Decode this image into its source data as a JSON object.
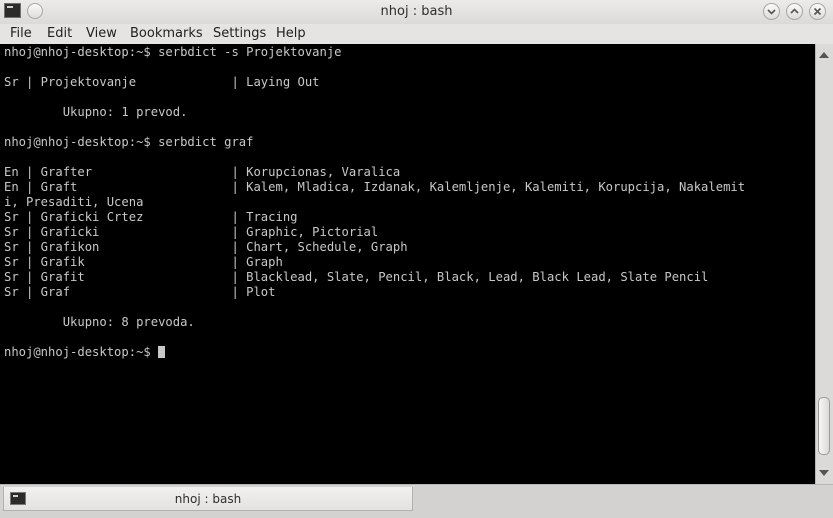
{
  "window": {
    "title": "nhoj : bash"
  },
  "menu": {
    "items": [
      "File",
      "Edit",
      "View",
      "Bookmarks",
      "Settings",
      "Help"
    ]
  },
  "terminal": {
    "lines": [
      "nhoj@nhoj-desktop:~$ serbdict -s Projektovanje",
      "",
      "Sr | Projektovanje             | Laying Out",
      "",
      "        Ukupno: 1 prevod.",
      "",
      "nhoj@nhoj-desktop:~$ serbdict graf",
      "",
      "En | Grafter                   | Korupcionas, Varalica",
      "En | Graft                     | Kalem, Mladica, Izdanak, Kalemljenje, Kalemiti, Korupcija, Nakalemit",
      "i, Presaditi, Ucena",
      "Sr | Graficki Crtez            | Tracing",
      "Sr | Graficki                  | Graphic, Pictorial",
      "Sr | Grafikon                  | Chart, Schedule, Graph",
      "Sr | Grafik                    | Graph",
      "Sr | Grafit                    | Blacklead, Slate, Pencil, Black, Lead, Black Lead, Slate Pencil",
      "Sr | Graf                      | Plot",
      "",
      "        Ukupno: 8 prevoda.",
      "",
      "nhoj@nhoj-desktop:~$ "
    ]
  },
  "tabs": [
    {
      "label": "nhoj : bash"
    }
  ],
  "icons": {
    "app": "terminal-icon",
    "pin": "pin-icon",
    "minimize": "chevron-down-icon",
    "maximize": "chevron-up-icon",
    "close": "close-icon",
    "tab": "terminal-icon"
  },
  "colors": {
    "terminal_background": "#000000",
    "terminal_text": "#c8c8c8"
  }
}
